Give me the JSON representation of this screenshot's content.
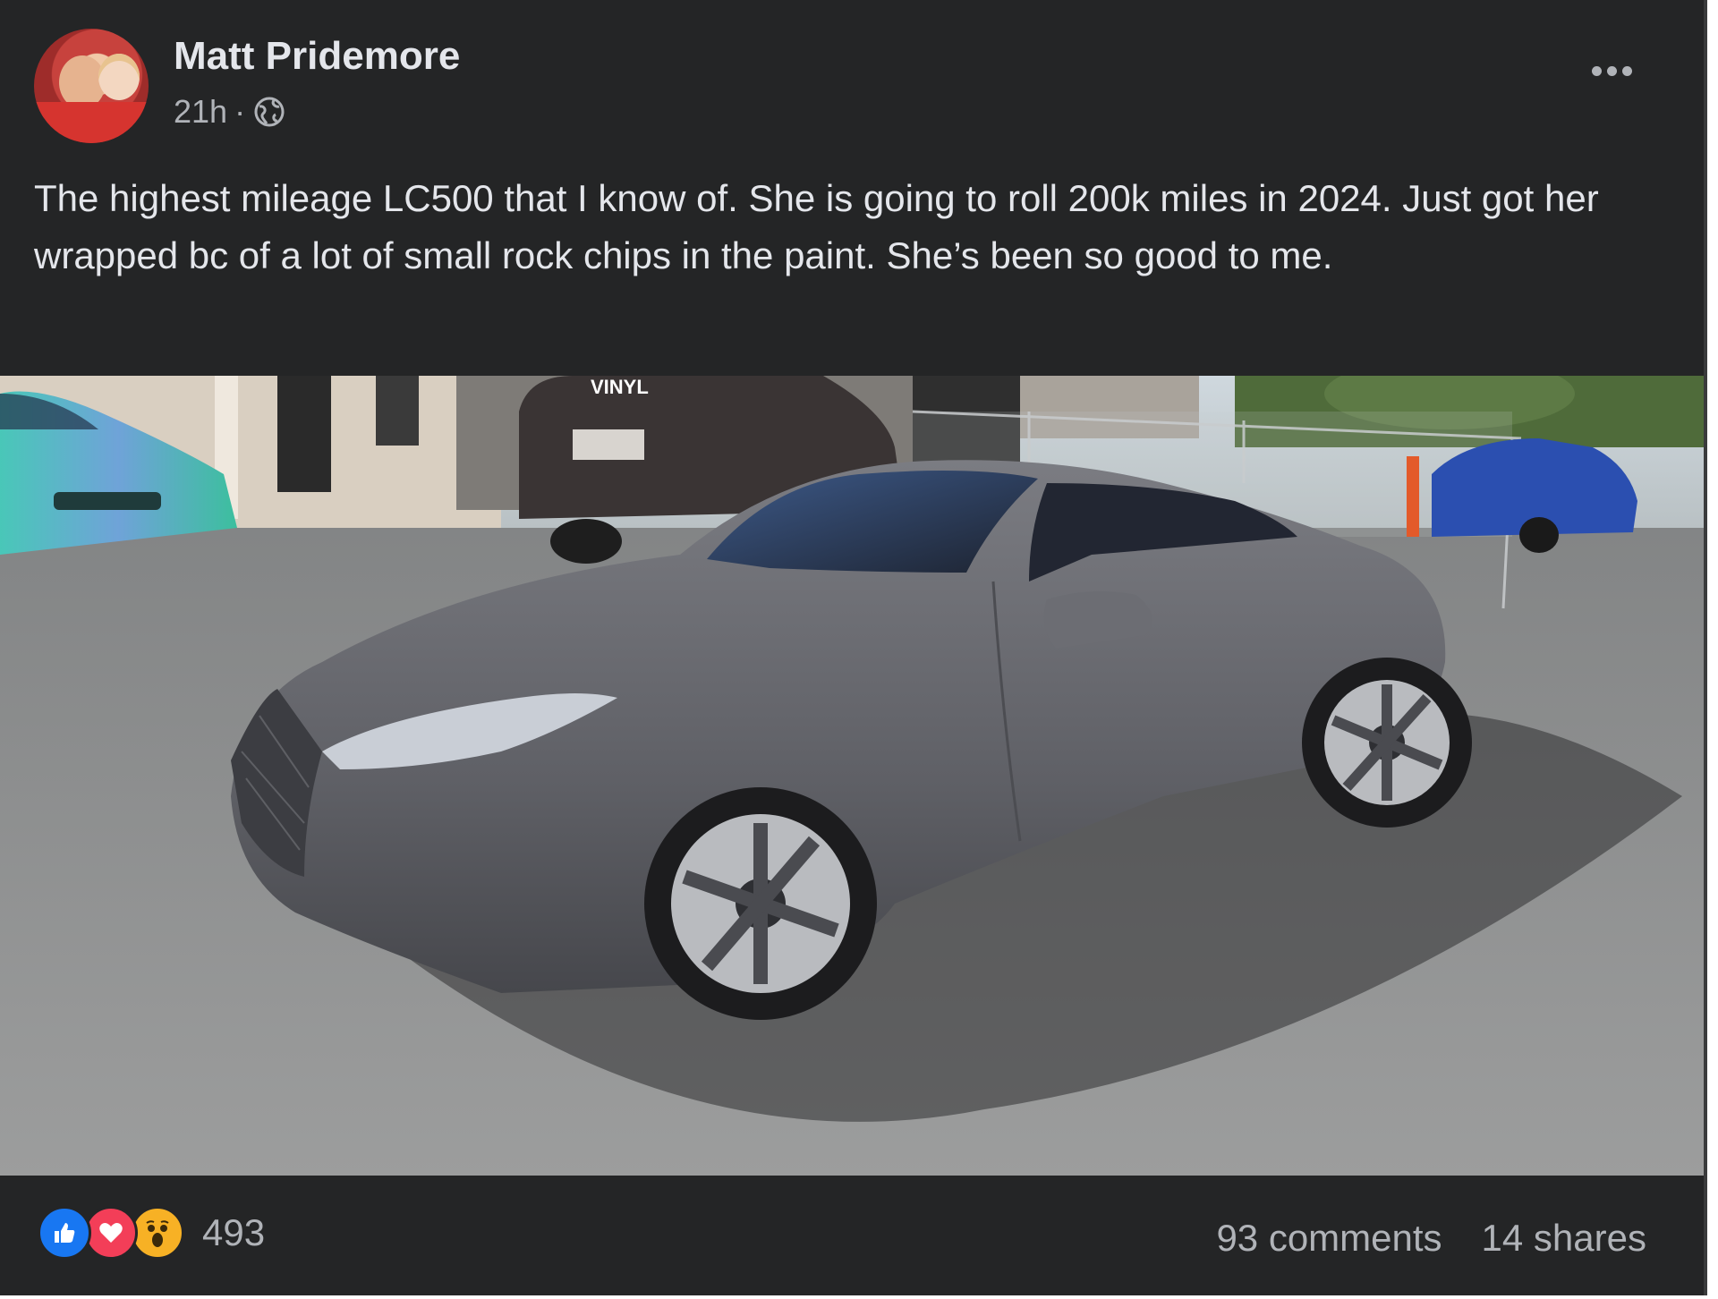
{
  "post": {
    "author": "Matt Pridemore",
    "time": "21h",
    "separator": "·",
    "privacy_icon": "globe-icon",
    "menu_icon": "more-options-icon",
    "text": "The highest mileage LC500 that I know of. She is going to roll 200k miles in 2024. Just got her wrapped bc of a lot of small rock chips in the paint. She’s been so good to me."
  },
  "photo": {
    "sign_text": "VINYL"
  },
  "footer": {
    "reaction_icons": [
      "like-icon",
      "love-icon",
      "wow-icon"
    ],
    "reaction_count": "493",
    "comments": "93 comments",
    "shares": "14 shares"
  },
  "colors": {
    "background": "#242526",
    "text_primary": "#e4e6eb",
    "text_secondary": "#b0b3b8",
    "like": "#1877f2",
    "love": "#f33e58",
    "wow": "#f7b125"
  }
}
